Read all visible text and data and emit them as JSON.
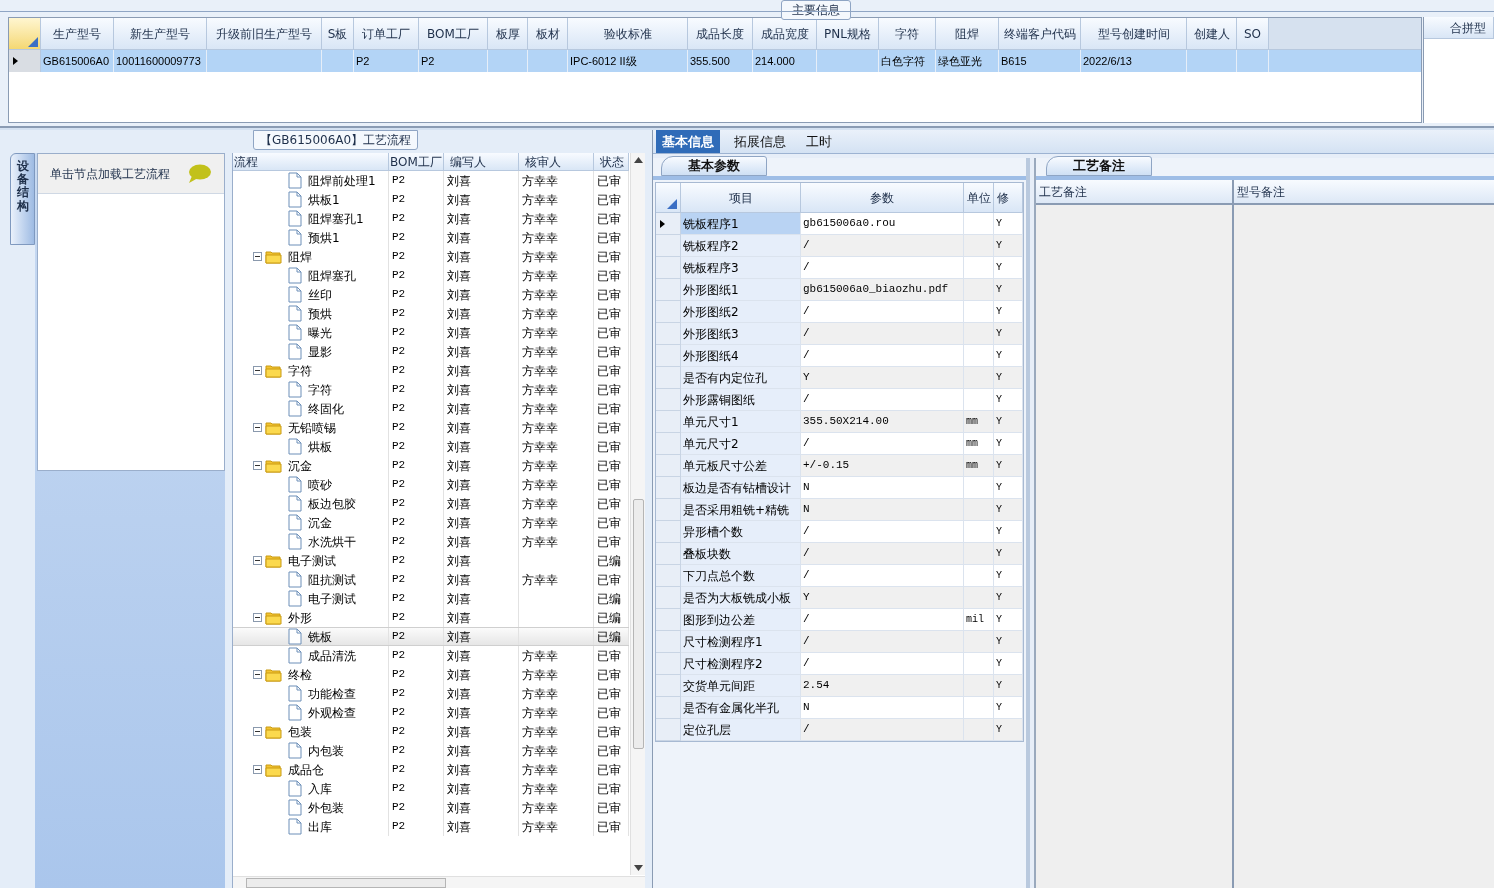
{
  "main_group": {
    "title": "主要信息",
    "columns": [
      "生产型号",
      "新生产型号",
      "升级前旧生产型号",
      "S板",
      "订单工厂",
      "BOM工厂",
      "板厚",
      "板材",
      "验收标准",
      "成品长度",
      "成品宽度",
      "PNL规格",
      "字符",
      "阻焊",
      "终端客户代码",
      "型号创建时间",
      "创建人",
      "SO"
    ],
    "rows": [
      {
        "selected": true,
        "cells": [
          "GB615006A0",
          "10011600009773",
          null,
          null,
          "P2",
          "P2",
          null,
          null,
          "IPC-6012 II级",
          "355.500",
          "214.000",
          null,
          "白色字符",
          "绿色亚光",
          "B615",
          "2022/6/13",
          null,
          null
        ]
      }
    ],
    "side_column": "合拼型"
  },
  "process_panel": {
    "title": "【GB615006A0】工艺流程",
    "side_tab": "设备结构",
    "hint": "单击节点加载工艺流程",
    "columns": [
      "流程",
      "BOM工厂",
      "编写人",
      "核审人",
      "状态"
    ],
    "continued_children": [
      {
        "name": "阻焊前处理1",
        "bom": "P2",
        "author": "刘喜",
        "reviewer": "方幸幸",
        "status": "已审",
        "selected": false
      },
      {
        "name": "烘板1",
        "bom": "P2",
        "author": "刘喜",
        "reviewer": "方幸幸",
        "status": "已审",
        "selected": false
      },
      {
        "name": "阻焊塞孔1",
        "bom": "P2",
        "author": "刘喜",
        "reviewer": "方幸幸",
        "status": "已审",
        "selected": false
      },
      {
        "name": "预烘1",
        "bom": "P2",
        "author": "刘喜",
        "reviewer": "方幸幸",
        "status": "已审",
        "selected": false
      }
    ],
    "nodes": [
      {
        "name": "阻焊",
        "bom": "P2",
        "author": "刘喜",
        "reviewer": "方幸幸",
        "status": "已审",
        "selected": false,
        "expanded": true,
        "children": [
          {
            "name": "阻焊塞孔",
            "bom": "P2",
            "author": "刘喜",
            "reviewer": "方幸幸",
            "status": "已审",
            "selected": false
          },
          {
            "name": "丝印",
            "bom": "P2",
            "author": "刘喜",
            "reviewer": "方幸幸",
            "status": "已审",
            "selected": false
          },
          {
            "name": "预烘",
            "bom": "P2",
            "author": "刘喜",
            "reviewer": "方幸幸",
            "status": "已审",
            "selected": false
          },
          {
            "name": "曝光",
            "bom": "P2",
            "author": "刘喜",
            "reviewer": "方幸幸",
            "status": "已审",
            "selected": false
          },
          {
            "name": "显影",
            "bom": "P2",
            "author": "刘喜",
            "reviewer": "方幸幸",
            "status": "已审",
            "selected": false
          }
        ]
      },
      {
        "name": "字符",
        "bom": "P2",
        "author": "刘喜",
        "reviewer": "方幸幸",
        "status": "已审",
        "selected": false,
        "expanded": true,
        "children": [
          {
            "name": "字符",
            "bom": "P2",
            "author": "刘喜",
            "reviewer": "方幸幸",
            "status": "已审",
            "selected": false
          },
          {
            "name": "终固化",
            "bom": "P2",
            "author": "刘喜",
            "reviewer": "方幸幸",
            "status": "已审",
            "selected": false
          }
        ]
      },
      {
        "name": "无铅喷锡",
        "bom": "P2",
        "author": "刘喜",
        "reviewer": "方幸幸",
        "status": "已审",
        "selected": false,
        "expanded": true,
        "children": [
          {
            "name": "烘板",
            "bom": "P2",
            "author": "刘喜",
            "reviewer": "方幸幸",
            "status": "已审",
            "selected": false
          }
        ]
      },
      {
        "name": "沉金",
        "bom": "P2",
        "author": "刘喜",
        "reviewer": "方幸幸",
        "status": "已审",
        "selected": false,
        "expanded": true,
        "children": [
          {
            "name": "喷砂",
            "bom": "P2",
            "author": "刘喜",
            "reviewer": "方幸幸",
            "status": "已审",
            "selected": false
          },
          {
            "name": "板边包胶",
            "bom": "P2",
            "author": "刘喜",
            "reviewer": "方幸幸",
            "status": "已审",
            "selected": false
          },
          {
            "name": "沉金",
            "bom": "P2",
            "author": "刘喜",
            "reviewer": "方幸幸",
            "status": "已审",
            "selected": false
          },
          {
            "name": "水洗烘干",
            "bom": "P2",
            "author": "刘喜",
            "reviewer": "方幸幸",
            "status": "已审",
            "selected": false
          }
        ]
      },
      {
        "name": "电子测试",
        "bom": "P2",
        "author": "刘喜",
        "status": "已编",
        "selected": false,
        "expanded": true,
        "children": [
          {
            "name": "阻抗测试",
            "bom": "P2",
            "author": "刘喜",
            "reviewer": "方幸幸",
            "status": "已审",
            "selected": false
          },
          {
            "name": "电子测试",
            "bom": "P2",
            "author": "刘喜",
            "status": "已编",
            "selected": false
          }
        ]
      },
      {
        "name": "外形",
        "bom": "P2",
        "author": "刘喜",
        "status": "已编",
        "selected": false,
        "expanded": true,
        "children": [
          {
            "name": "铣板",
            "bom": "P2",
            "author": "刘喜",
            "status": "已编",
            "selected": true
          },
          {
            "name": "成品清洗",
            "bom": "P2",
            "author": "刘喜",
            "reviewer": "方幸幸",
            "status": "已审",
            "selected": false
          }
        ]
      },
      {
        "name": "终检",
        "bom": "P2",
        "author": "刘喜",
        "reviewer": "方幸幸",
        "status": "已审",
        "selected": false,
        "expanded": true,
        "children": [
          {
            "name": "功能检查",
            "bom": "P2",
            "author": "刘喜",
            "reviewer": "方幸幸",
            "status": "已审",
            "selected": false
          },
          {
            "name": "外观检查",
            "bom": "P2",
            "author": "刘喜",
            "reviewer": "方幸幸",
            "status": "已审",
            "selected": false
          }
        ]
      },
      {
        "name": "包装",
        "bom": "P2",
        "author": "刘喜",
        "reviewer": "方幸幸",
        "status": "已审",
        "selected": false,
        "expanded": true,
        "children": [
          {
            "name": "内包装",
            "bom": "P2",
            "author": "刘喜",
            "reviewer": "方幸幸",
            "status": "已审",
            "selected": false
          }
        ]
      },
      {
        "name": "成品仓",
        "bom": "P2",
        "author": "刘喜",
        "reviewer": "方幸幸",
        "status": "已审",
        "selected": false,
        "expanded": true,
        "children": [
          {
            "name": "入库",
            "bom": "P2",
            "author": "刘喜",
            "reviewer": "方幸幸",
            "status": "已审",
            "selected": false
          },
          {
            "name": "外包装",
            "bom": "P2",
            "author": "刘喜",
            "reviewer": "方幸幸",
            "status": "已审",
            "selected": false
          },
          {
            "name": "出库",
            "bom": "P2",
            "author": "刘喜",
            "reviewer": "方幸幸",
            "status": "已审",
            "selected": false
          }
        ]
      }
    ]
  },
  "detail_tabs": [
    {
      "label": "基本信息",
      "selected": true
    },
    {
      "label": "拓展信息",
      "selected": false
    },
    {
      "label": "工时",
      "selected": false
    }
  ],
  "params": {
    "tab": "基本参数",
    "columns": [
      "项目",
      "参数",
      "单位",
      "修"
    ],
    "rows": [
      {
        "item": "铣板程序1",
        "value": "gb615006a0.rou",
        "modified": "Y",
        "selected": true
      },
      {
        "item": "铣板程序2",
        "value": "/",
        "modified": "Y",
        "selected": false
      },
      {
        "item": "铣板程序3",
        "value": "/",
        "modified": "Y",
        "selected": false
      },
      {
        "item": "外形图纸1",
        "value": "gb615006a0_biaozhu.pdf",
        "modified": "Y",
        "selected": false
      },
      {
        "item": "外形图纸2",
        "value": "/",
        "modified": "Y",
        "selected": false
      },
      {
        "item": "外形图纸3",
        "value": "/",
        "modified": "Y",
        "selected": false
      },
      {
        "item": "外形图纸4",
        "value": "/",
        "modified": "Y",
        "selected": false
      },
      {
        "item": "是否有内定位孔",
        "value": "Y",
        "modified": "Y",
        "selected": false
      },
      {
        "item": "外形露铜图纸",
        "value": "/",
        "modified": "Y",
        "selected": false
      },
      {
        "item": "单元尺寸1",
        "value": "355.50X214.00",
        "unit": "mm",
        "modified": "Y",
        "selected": false
      },
      {
        "item": "单元尺寸2",
        "value": "/",
        "unit": "mm",
        "modified": "Y",
        "selected": false
      },
      {
        "item": "单元板尺寸公差",
        "value": "+/-0.15",
        "unit": "mm",
        "modified": "Y",
        "selected": false
      },
      {
        "item": "板边是否有钻槽设计",
        "value": "N",
        "modified": "Y",
        "selected": false
      },
      {
        "item": "是否采用粗铣+精铣",
        "value": "N",
        "modified": "Y",
        "selected": false
      },
      {
        "item": "异形槽个数",
        "value": "/",
        "modified": "Y",
        "selected": false
      },
      {
        "item": "叠板块数",
        "value": "/",
        "modified": "Y",
        "selected": false
      },
      {
        "item": "下刀点总个数",
        "value": "/",
        "modified": "Y",
        "selected": false
      },
      {
        "item": "是否为大板铣成小板",
        "value": "Y",
        "modified": "Y",
        "selected": false
      },
      {
        "item": "图形到边公差",
        "value": "/",
        "unit": "mil",
        "modified": "Y",
        "selected": false
      },
      {
        "item": "尺寸检测程序1",
        "value": "/",
        "modified": "Y",
        "selected": false
      },
      {
        "item": "尺寸检测程序2",
        "value": "/",
        "modified": "Y",
        "selected": false
      },
      {
        "item": "交货单元间距",
        "value": "2.54",
        "modified": "Y",
        "selected": false
      },
      {
        "item": "是否有金属化半孔",
        "value": "N",
        "modified": "Y",
        "selected": false
      },
      {
        "item": "定位孔层",
        "value": "/",
        "modified": "Y",
        "selected": false
      }
    ]
  },
  "notes": {
    "tab": "工艺备注",
    "columns": [
      "工艺备注",
      "型号备注"
    ]
  }
}
